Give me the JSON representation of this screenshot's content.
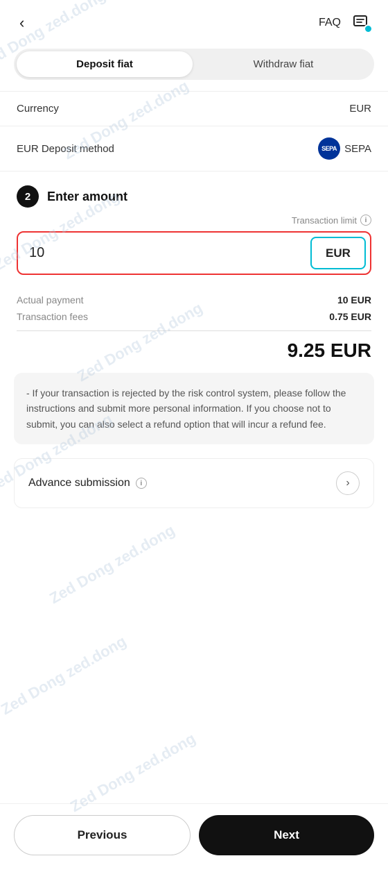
{
  "header": {
    "back_label": "‹",
    "faq_label": "FAQ"
  },
  "tabs": {
    "deposit_label": "Deposit fiat",
    "withdraw_label": "Withdraw fiat",
    "active": "deposit"
  },
  "info_rows": [
    {
      "label": "Currency",
      "value": "EUR",
      "has_icon": false
    },
    {
      "label": "EUR Deposit method",
      "value": "SEPA",
      "has_icon": true
    }
  ],
  "enter_amount": {
    "step_number": "2",
    "title": "Enter amount",
    "transaction_limit_label": "Transaction limit",
    "amount_value": "10",
    "currency": "EUR",
    "actual_payment_label": "Actual payment",
    "actual_payment_value": "10 EUR",
    "transaction_fees_label": "Transaction fees",
    "transaction_fees_value": "0.75 EUR",
    "total_value": "9.25 EUR"
  },
  "notice": {
    "text": "- If your transaction is rejected by the risk control system, please follow the instructions and submit more personal information. If you choose not to submit, you can also select a refund option that will incur a refund fee."
  },
  "advance_submission": {
    "label": "Advance submission",
    "info_icon": "i"
  },
  "buttons": {
    "previous_label": "Previous",
    "next_label": "Next"
  },
  "sepa_text": "SEPA",
  "watermark_text": "Zed Dong zed.dong"
}
